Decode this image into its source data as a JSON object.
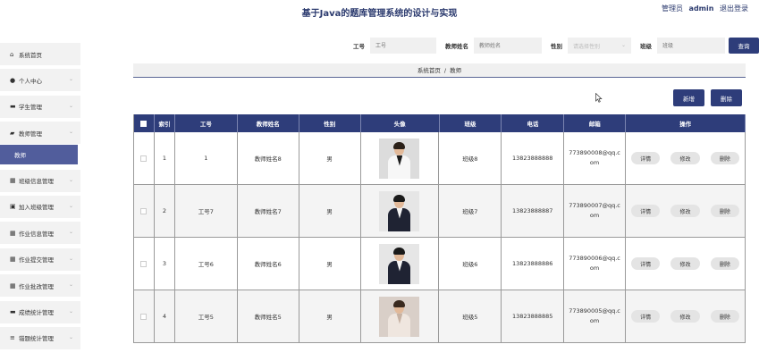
{
  "header": {
    "title": "基于Java的题库管理系统的设计与实现",
    "role": "管理员",
    "username": "admin",
    "logout": "退出登录"
  },
  "sidebar": {
    "items": [
      {
        "label": "系统首页",
        "icon": "home-icon",
        "glyph": "⌂",
        "chevron": false
      },
      {
        "label": "个人中心",
        "icon": "person-icon",
        "glyph": "●",
        "chevron": true
      },
      {
        "label": "学生管理",
        "icon": "student-icon",
        "glyph": "▬",
        "chevron": true
      },
      {
        "label": "教师管理",
        "icon": "teacher-icon",
        "glyph": "▰",
        "chevron": true,
        "expanded": true
      },
      {
        "label": "班级信息管理",
        "icon": "grid-icon",
        "glyph": "▦",
        "chevron": true
      },
      {
        "label": "加入班级管理",
        "icon": "join-icon",
        "glyph": "▣",
        "chevron": true
      },
      {
        "label": "作业信息管理",
        "icon": "grid-icon",
        "glyph": "▦",
        "chevron": true
      },
      {
        "label": "作业提交管理",
        "icon": "grid-icon",
        "glyph": "▦",
        "chevron": true
      },
      {
        "label": "作业批改管理",
        "icon": "grid-icon",
        "glyph": "▦",
        "chevron": true
      },
      {
        "label": "成绩统计管理",
        "icon": "chat-icon",
        "glyph": "▬",
        "chevron": true
      },
      {
        "label": "错题统计管理",
        "icon": "list-icon",
        "glyph": "≡",
        "chevron": true
      }
    ],
    "sub_item": "教师"
  },
  "search": {
    "gonghao_label": "工号",
    "gonghao_placeholder": "工号",
    "name_label": "教师姓名",
    "name_placeholder": "教师姓名",
    "gender_label": "性别",
    "gender_placeholder": "请选择性别",
    "class_label": "班级",
    "class_placeholder": "班级",
    "button": "查询"
  },
  "breadcrumb": {
    "home": "系统首页",
    "sep": "/",
    "current": "教师"
  },
  "actions": {
    "add": "新增",
    "delete": "删除"
  },
  "table": {
    "headers": [
      "索引",
      "工号",
      "教师姓名",
      "性别",
      "头像",
      "班级",
      "电话",
      "邮箱",
      "操作"
    ],
    "row_buttons": [
      "详情",
      "修改",
      "删除"
    ],
    "rows": [
      {
        "index": "1",
        "gonghao": "1",
        "name": "教师姓名8",
        "gender": "男",
        "class": "班级8",
        "phone": "13823888888",
        "email": "773890008@qq.com",
        "photo": "female-white-top-photo"
      },
      {
        "index": "2",
        "gonghao": "工号7",
        "name": "教师姓名7",
        "gender": "男",
        "class": "班级7",
        "phone": "13823888887",
        "email": "773890007@qq.com",
        "photo": "male-dark-suit-photo"
      },
      {
        "index": "3",
        "gonghao": "工号6",
        "name": "教师姓名6",
        "gender": "男",
        "class": "班级6",
        "phone": "13823888886",
        "email": "773890006@qq.com",
        "photo": "male-dark-suit-photo"
      },
      {
        "index": "4",
        "gonghao": "工号5",
        "name": "教师姓名5",
        "gender": "男",
        "class": "班级5",
        "phone": "13823888885",
        "email": "773890005@qq.com",
        "photo": "female-light-top-photo"
      }
    ]
  },
  "colors": {
    "accent": "#2e3d7a",
    "submenu": "#515d9c"
  }
}
